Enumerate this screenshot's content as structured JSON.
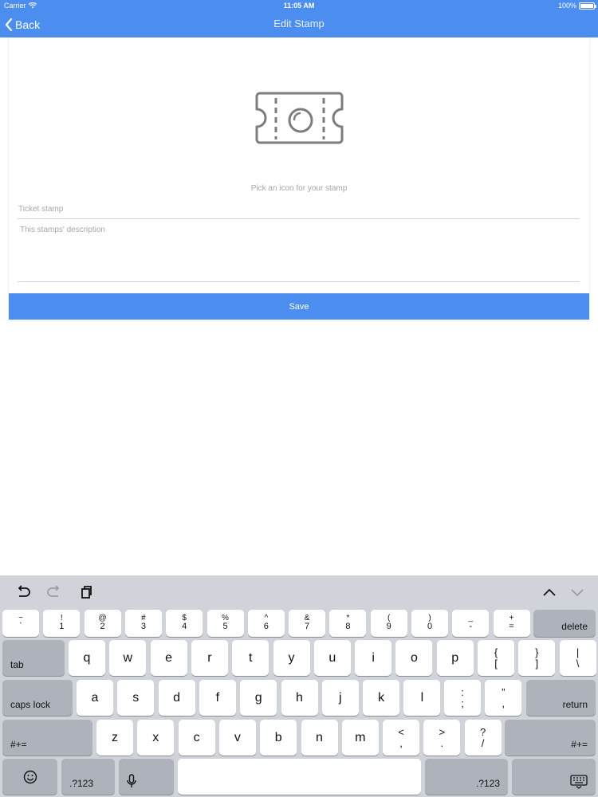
{
  "status_bar": {
    "carrier": "Carrier",
    "time": "11:05 AM",
    "battery": "100%"
  },
  "nav": {
    "back_label": "Back",
    "title": "Edit Stamp"
  },
  "form": {
    "icon": "ticket-icon",
    "pick_icon_label": "Pick an icon for your stamp",
    "title_placeholder": "Ticket stamp",
    "description_placeholder": "This stamps' description",
    "save_label": "Save"
  },
  "keyboard": {
    "row1": [
      {
        "top": "~",
        "bot": "`"
      },
      {
        "top": "!",
        "bot": "1"
      },
      {
        "top": "@",
        "bot": "2"
      },
      {
        "top": "#",
        "bot": "3"
      },
      {
        "top": "$",
        "bot": "4"
      },
      {
        "top": "%",
        "bot": "5"
      },
      {
        "top": "^",
        "bot": "6"
      },
      {
        "top": "&",
        "bot": "7"
      },
      {
        "top": "*",
        "bot": "8"
      },
      {
        "top": "(",
        "bot": "9"
      },
      {
        "top": ")",
        "bot": "0"
      },
      {
        "top": "_",
        "bot": "-"
      },
      {
        "top": "+",
        "bot": "="
      }
    ],
    "delete_label": "delete",
    "tab_label": "tab",
    "row2_letters": [
      "q",
      "w",
      "e",
      "r",
      "t",
      "y",
      "u",
      "i",
      "o",
      "p"
    ],
    "row2_symbols": [
      {
        "top": "{",
        "bot": "["
      },
      {
        "top": "}",
        "bot": "]"
      },
      {
        "top": "|",
        "bot": "\\"
      }
    ],
    "caps_label": "caps lock",
    "row3_letters": [
      "a",
      "s",
      "d",
      "f",
      "g",
      "h",
      "j",
      "k",
      "l"
    ],
    "row3_symbols": [
      {
        "top": ":",
        "bot": ";"
      },
      {
        "top": "”",
        "bot": ","
      }
    ],
    "return_label": "return",
    "symbols_label": "#+=",
    "row4_letters": [
      "z",
      "x",
      "c",
      "v",
      "b",
      "n",
      "m"
    ],
    "row4_symbols": [
      {
        "top": "<",
        "bot": ","
      },
      {
        "top": ">",
        "bot": "."
      },
      {
        "top": "?",
        "bot": "/"
      }
    ],
    "numbers_label": ".?123"
  }
}
